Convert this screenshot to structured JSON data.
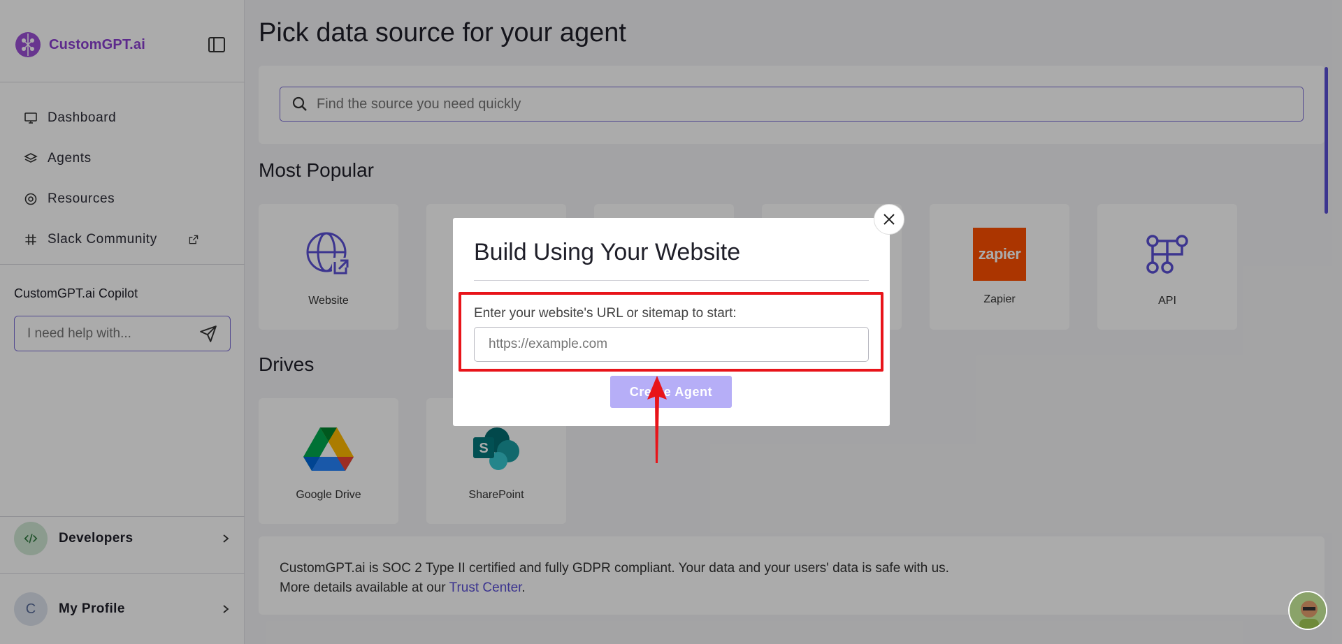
{
  "brand": {
    "name": "CustomGPT.ai"
  },
  "sidebar": {
    "nav": [
      {
        "label": "Dashboard",
        "icon": "monitor-icon"
      },
      {
        "label": "Agents",
        "icon": "layers-icon"
      },
      {
        "label": "Resources",
        "icon": "lifebuoy-icon"
      },
      {
        "label": "Slack Community",
        "icon": "slack-icon",
        "external": true
      }
    ],
    "copilot": {
      "title": "CustomGPT.ai Copilot",
      "placeholder": "I need help with..."
    },
    "developers": {
      "label": "Developers"
    },
    "profile": {
      "label": "My Profile",
      "initial": "C"
    }
  },
  "main": {
    "title": "Pick data source for your agent",
    "search_placeholder": "Find the source you need quickly",
    "most_popular": {
      "title": "Most Popular",
      "cards": [
        {
          "label": "Website"
        },
        {
          "label": "Zapier"
        },
        {
          "label": "API"
        }
      ]
    },
    "drives": {
      "title": "Drives",
      "cards": [
        {
          "label": "Google Drive"
        },
        {
          "label": "SharePoint"
        }
      ]
    },
    "compliance": {
      "line1": "CustomGPT.ai is SOC 2 Type II certified and fully GDPR compliant. Your data and your users' data is safe with us.",
      "line2_prefix": "More details available at our ",
      "link": "Trust Center",
      "line2_suffix": "."
    }
  },
  "modal": {
    "title": "Build Using Your Website",
    "label": "Enter your website's URL or sitemap to start:",
    "placeholder": "https://example.com",
    "button": "Create Agent"
  },
  "colors": {
    "accent": "#5a4fd6",
    "highlight": "#e8141a",
    "brand": "#8b3fd1"
  }
}
